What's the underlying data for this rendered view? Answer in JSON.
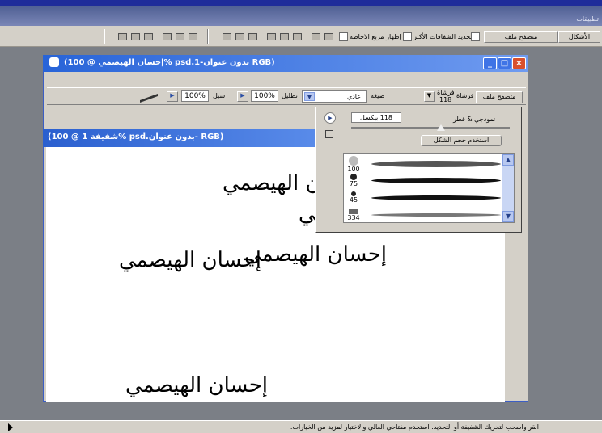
{
  "menu": {
    "trailing": "تطبيقات"
  },
  "options_bar": {
    "tab_shapes": "الأشكال",
    "tab_file_browser": "متصفح ملف",
    "checkbox1_label": "تحديد الشفافات الأكثر",
    "checkbox2_label": "إظهار مربع الاحاطة"
  },
  "document_window": {
    "title": "(إحسان الهيصمي @ 100% psd.بدون عنوان-1    RGB)",
    "controls": {
      "minimize": "_",
      "maximize": "□",
      "close": "×"
    }
  },
  "brush_options_bar": {
    "tab_file_browser": "متصفح ملف",
    "tab_brushes": "فرشاة",
    "brush_size_label": "فرشاة",
    "brush_size_value": "118",
    "mode_label": "صيغة",
    "mode_value": "عادي",
    "opacity_label": "تظليل",
    "opacity_value": "100%",
    "flow_label": "سيل",
    "flow_value": "100%"
  },
  "inner_document": {
    "title": "(شفيفة 1 @ 100% psd.بدون عنوان-   RGB)",
    "texts": [
      "إحسان الهيصمي",
      "مي",
      "إحسان الهيصمي",
      "إحسان الهيصمي",
      "إحسان الهيصمي"
    ]
  },
  "brush_panel": {
    "diameter_label": "نموذجي & قطر",
    "diameter_value": "118 بيكسل",
    "reset_button": "استخدم حجم الشكل",
    "brushes": [
      {
        "size": "100"
      },
      {
        "size": "75"
      },
      {
        "size": "45"
      },
      {
        "size": "334"
      }
    ]
  },
  "status_bar": {
    "text": "انقر واسحب لتحريك الشفيفة أو التحديد. استخدم مفتاحي العالي والاختيار لمزيد من الخيارات."
  }
}
